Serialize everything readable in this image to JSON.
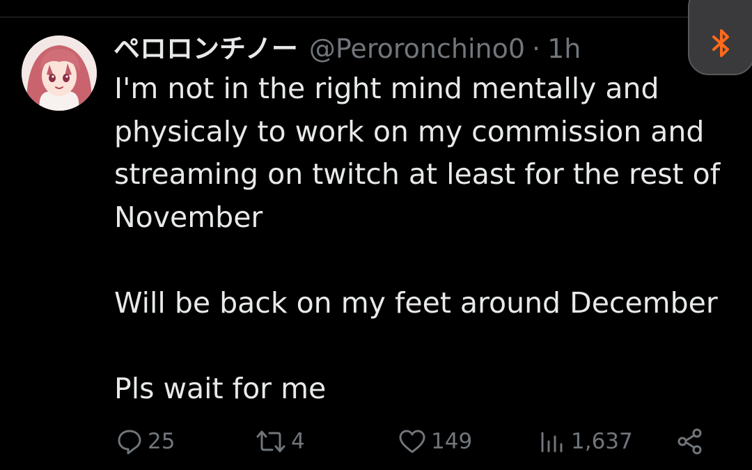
{
  "colors": {
    "background": "#000000",
    "primary_text": "#e7e9ea",
    "secondary_text": "#71767b",
    "divider": "#2f3336",
    "bluetooth_accent": "#ff6a1a"
  },
  "overlay": {
    "icon": "bluetooth-icon"
  },
  "tweet": {
    "author": {
      "display_name": "ペロロンチノー",
      "handle": "@Peroronchino0",
      "separator": "·",
      "time": "1h"
    },
    "text": "I'm not in the right mind mentally and\nphysicaly to work on my commission and\nstreaming on twitch at least for the rest of\nNovember\n\nWill be back on my feet around December\n\nPls wait for me"
  },
  "actions": {
    "reply": {
      "icon": "reply-icon",
      "count": "25"
    },
    "retweet": {
      "icon": "retweet-icon",
      "count": "4"
    },
    "like": {
      "icon": "heart-icon",
      "count": "149"
    },
    "views": {
      "icon": "views-icon",
      "count": "1,637"
    },
    "share": {
      "icon": "share-icon"
    }
  }
}
